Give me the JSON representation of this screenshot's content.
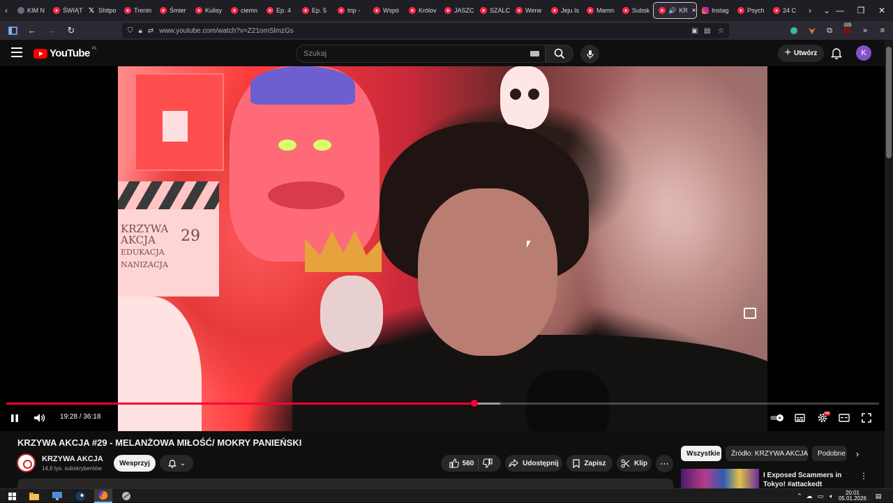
{
  "browser": {
    "tabs": [
      {
        "label": "KIM N",
        "icon": "blank-favicon"
      },
      {
        "label": "ŚWIĄT",
        "icon": "youtube-favicon"
      },
      {
        "label": "Shitpo",
        "icon": "x-favicon"
      },
      {
        "label": "Trenin",
        "icon": "youtube-favicon"
      },
      {
        "label": "Śmier",
        "icon": "youtube-favicon"
      },
      {
        "label": "Kulisy",
        "icon": "youtube-favicon"
      },
      {
        "label": "ciemn",
        "icon": "youtube-favicon"
      },
      {
        "label": "Ep. 4",
        "icon": "youtube-favicon"
      },
      {
        "label": "Ep. 5",
        "icon": "youtube-favicon"
      },
      {
        "label": "trip -",
        "icon": "youtube-favicon"
      },
      {
        "label": "Wspó",
        "icon": "youtube-favicon"
      },
      {
        "label": "Królov",
        "icon": "youtube-favicon"
      },
      {
        "label": "JASZC",
        "icon": "youtube-favicon"
      },
      {
        "label": "SZALC",
        "icon": "youtube-favicon"
      },
      {
        "label": "Wene",
        "icon": "youtube-favicon"
      },
      {
        "label": "Jeju Is",
        "icon": "youtube-favicon"
      },
      {
        "label": "Mamn",
        "icon": "youtube-favicon"
      },
      {
        "label": "Subsk",
        "icon": "youtube-favicon"
      }
    ],
    "active_tab": {
      "label": "KR",
      "icon": "youtube-favicon"
    },
    "tabs_after": [
      {
        "label": "Instag",
        "icon": "instagram-favicon"
      },
      {
        "label": "Psych",
        "icon": "youtube-favicon"
      },
      {
        "label": "24 C",
        "icon": "youtube-favicon"
      }
    ],
    "url": "www.youtube.com/watch?v=Z21omSlmzGs",
    "extension_badge": "125"
  },
  "youtube": {
    "logo_text": "YouTube",
    "country_code": "PL",
    "search_placeholder": "Szukaj",
    "create_label": "Utwórz",
    "avatar_letter": "K",
    "avatar_color": "#7e53c8"
  },
  "player": {
    "current_time": "19:28",
    "duration": "36:18",
    "played_fraction": 0.536,
    "buffered_fraction": 0.566,
    "accent_color": "#ff0033",
    "settings_badge": "HD",
    "frame_text": {
      "clapper_lines": [
        "KRZYWA",
        "AKCJA"
      ],
      "clapper_bottom": [
        "EDUKACJA",
        "NANIZACJA"
      ],
      "scene_number": "29"
    }
  },
  "video": {
    "title": "KRZYWA AKCJA #29 - MELANŻOWA MIŁOŚĆ/ MOKRY PANIEŃSKI",
    "channel_name": "KRZYWA AKCJA",
    "subscribers": "14,6 tys. subskrybentów",
    "support_label": "Wesprzyj",
    "like_count": "560",
    "share_label": "Udostępnij",
    "save_label": "Zapisz",
    "clip_label": "Klip"
  },
  "sidebar": {
    "chips": [
      "Wszystkie",
      "Źródło: KRZYWA AKCJA",
      "Podobne"
    ],
    "active_chip": "Wszystkie",
    "recommendation_title": "I Exposed Scammers in Tokyo! #attackedt"
  },
  "taskbar": {
    "time": "20:01",
    "date": "05.01.2026"
  }
}
